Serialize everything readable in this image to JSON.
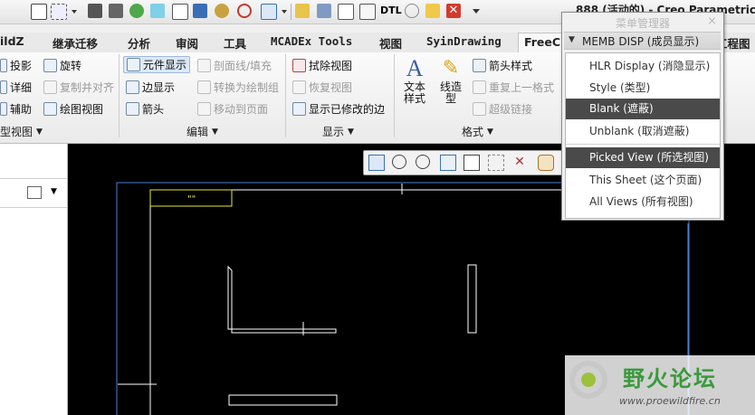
{
  "window": {
    "title": "888 (活动的) - Creo Parametric"
  },
  "quick_access": {
    "icons": [
      "quick-select-icon",
      "box-select-icon",
      "dropdown-icon",
      "print-icon",
      "print-settings-icon",
      "green-circle-icon",
      "shaded-icon",
      "sheet-icon",
      "layer-icon",
      "target-icon",
      "relayout-icon",
      "dropdown-icon",
      "pencil-icon",
      "page-setup-icon",
      "edit-note-icon",
      "dtl-icon",
      "clock-icon",
      "folder-icon",
      "close-icon",
      "more-icon"
    ],
    "dtl_label": "DTL"
  },
  "tabs": [
    {
      "label": "ildZ"
    },
    {
      "label": "继承迁移"
    },
    {
      "label": "分析"
    },
    {
      "label": "审阅"
    },
    {
      "label": "工具"
    },
    {
      "label": "MCADEx Tools"
    },
    {
      "label": "视图"
    },
    {
      "label": "SyinDrawing"
    },
    {
      "label": "FreeC"
    },
    {
      "label": "工程图"
    }
  ],
  "ribbon": {
    "model_views": {
      "projection": "投影",
      "rotate": "旋转",
      "detail": "详细",
      "copy_align": "复制并对齐",
      "auxiliary": "辅助",
      "drawing_view": "绘图视图",
      "group_label": "型视图"
    },
    "edit": {
      "component_display": "元件显示",
      "hatch": "剖面线/填充",
      "edge_display": "边显示",
      "convert_group": "转换为绘制组",
      "arrow": "箭头",
      "move_to_page": "移动到页面",
      "group_label": "编辑"
    },
    "display": {
      "erase_view": "拭除视图",
      "resume_view": "恢复视图",
      "show_modified_edges": "显示已修改的边",
      "group_label": "显示"
    },
    "format": {
      "text_style": "文本样式",
      "line_style": "线造型",
      "arrow_style": "箭头样式",
      "repeat_format": "重复上一格式",
      "hyperlink": "超级链接",
      "group_label": "格式"
    }
  },
  "view_toolbar": [
    "zoom-fit-icon",
    "zoom-in-icon",
    "zoom-out-icon",
    "refit-icon",
    "orient-cube-icon",
    "annotation-display-icon",
    "datum-display-icon",
    "spin-center-icon"
  ],
  "canvas": {
    "title_cell_text": "\"\""
  },
  "menu_manager": {
    "title": "菜单管理器",
    "close": "×",
    "header": "MEMB DISP (成员显示)",
    "items": [
      {
        "label": "HLR Display (消隐显示)",
        "highlighted": false
      },
      {
        "label": "Style (类型)",
        "highlighted": false
      },
      {
        "label": "Blank (遮蔽)",
        "highlighted": true
      },
      {
        "label": "Unblank (取消遮蔽)",
        "highlighted": false
      },
      {
        "label": "Picked View (所选视图)",
        "highlighted": true
      },
      {
        "label": "This Sheet (这个页面)",
        "highlighted": false
      },
      {
        "label": "All Views (所有视图)",
        "highlighted": false
      }
    ]
  },
  "watermark": {
    "text": "野火论坛",
    "url": "www.proewildfire.cn"
  }
}
